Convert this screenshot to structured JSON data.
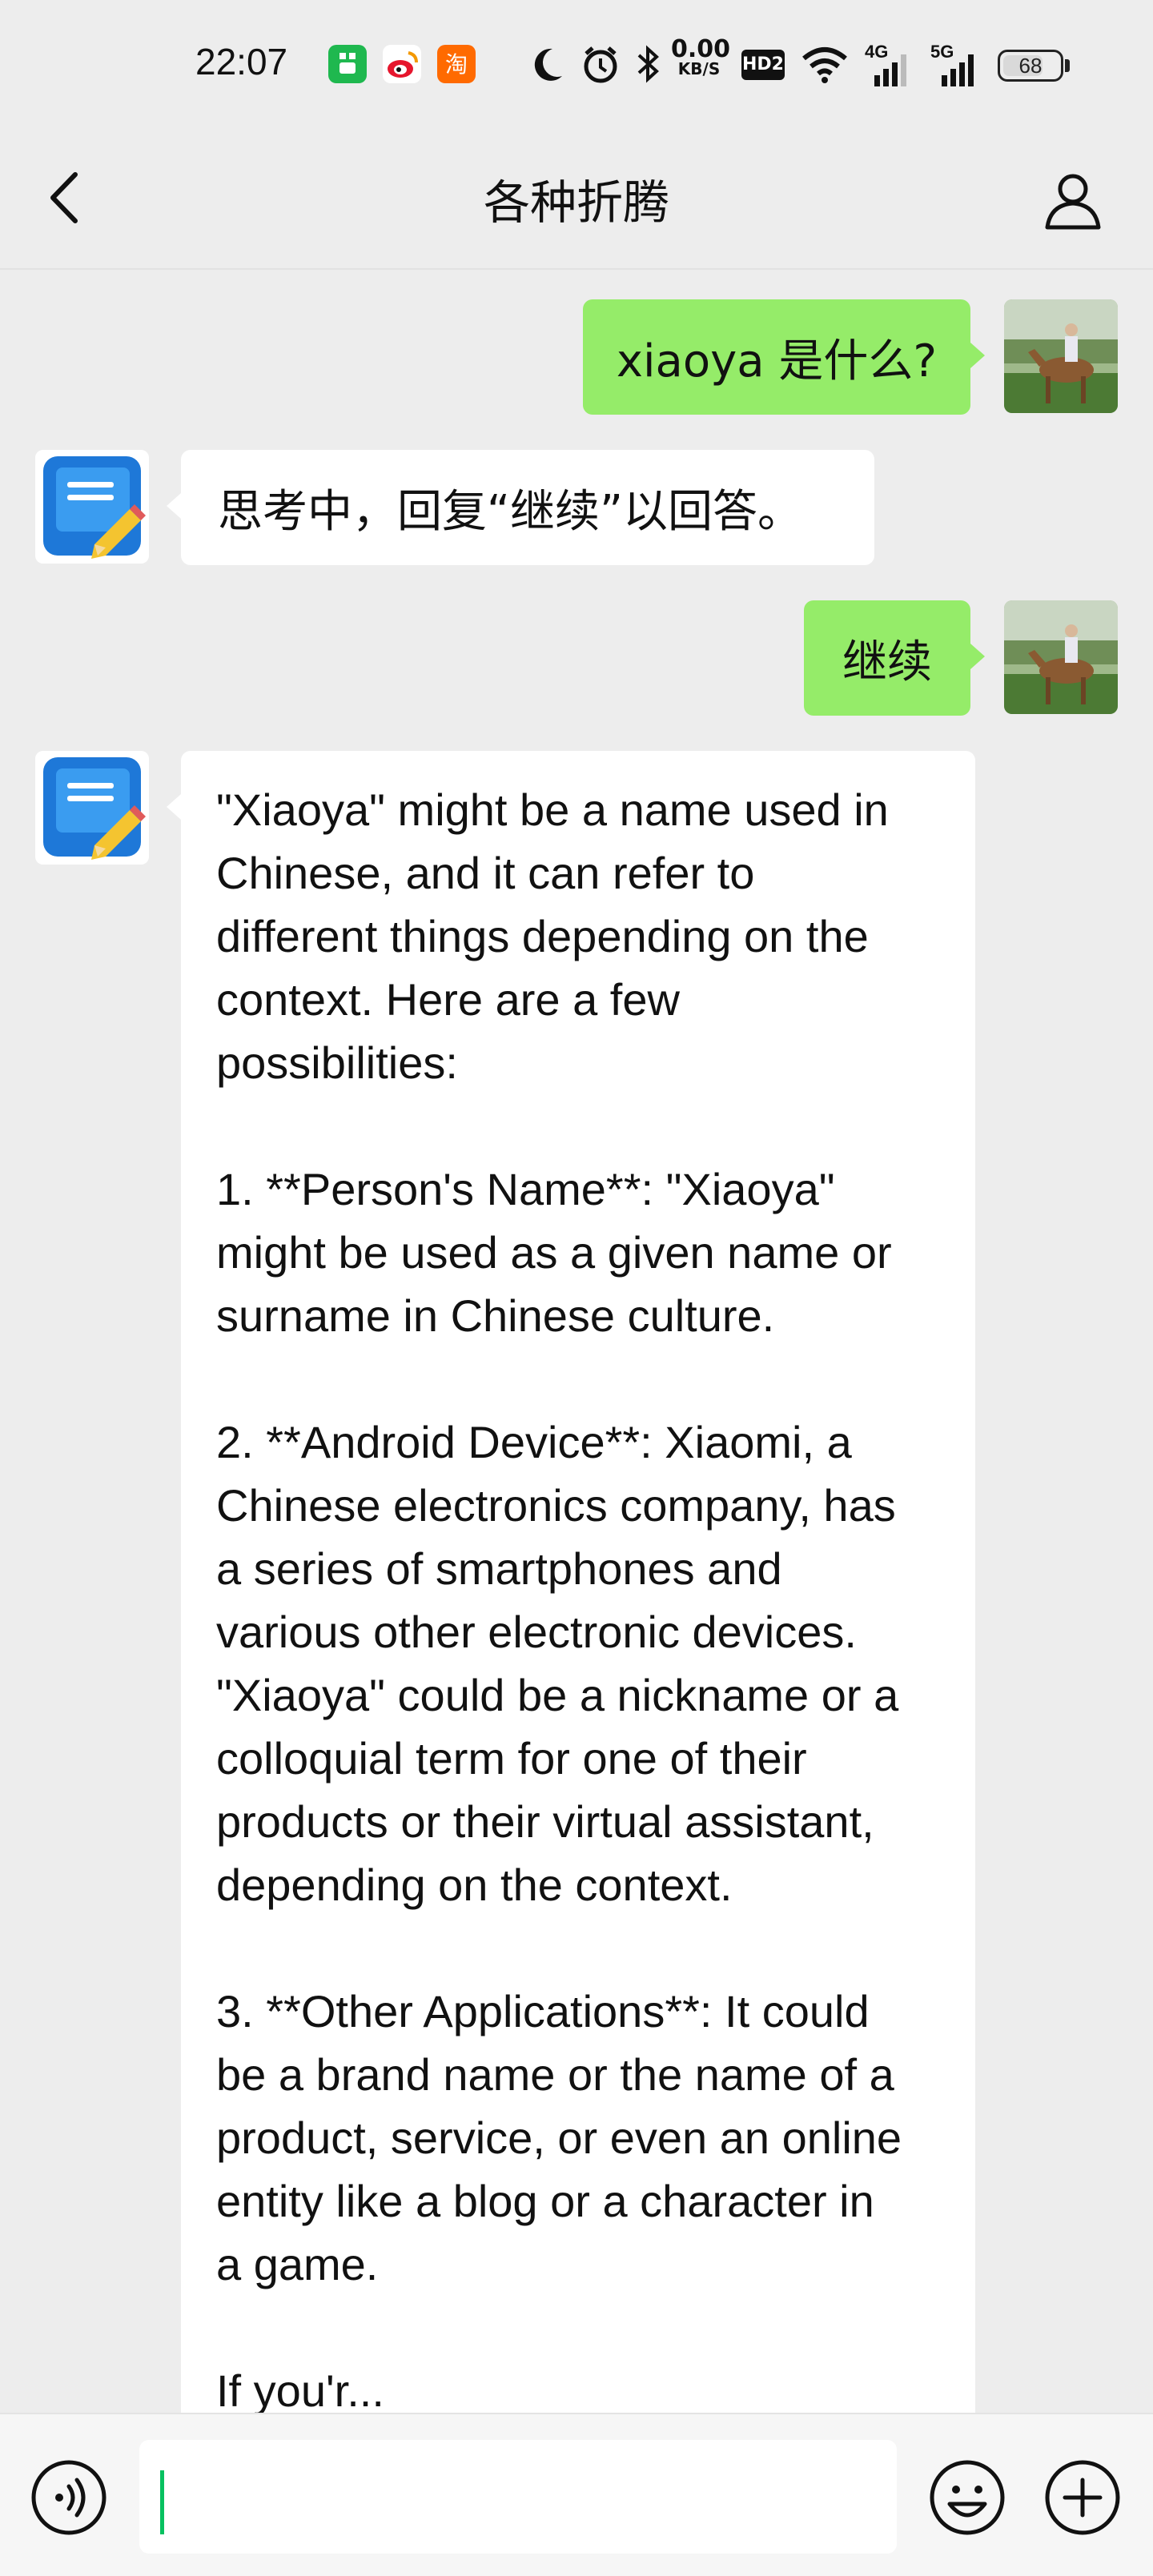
{
  "status_bar": {
    "time": "22:07",
    "net_speed_value": "0.00",
    "net_speed_unit": "KB/S",
    "hd_label": "HD2",
    "signal_4g_label": "4G",
    "signal_5g_label": "5G",
    "battery_level": "68",
    "icons": [
      "app-badge-green",
      "weibo-icon",
      "taobao-icon",
      "moon-icon",
      "alarm-icon",
      "bluetooth-icon",
      "wifi-icon"
    ]
  },
  "header": {
    "title": "各种折腾"
  },
  "messages": [
    {
      "sender": "me",
      "text": "xiaoya 是什么?"
    },
    {
      "sender": "bot",
      "text": "思考中，回复“继续”以回答。"
    },
    {
      "sender": "me",
      "text": "继续"
    },
    {
      "sender": "bot",
      "text": "\"Xiaoya\" might be a name used in\nChinese, and it can refer to\ndifferent things depending on the\ncontext. Here are a few\npossibilities:\n\n1. **Person's Name**: \"Xiaoya\"\nmight be used as a given name or\nsurname in Chinese culture.\n\n2. **Android Device**: Xiaomi, a\nChinese electronics company, has\na series of smartphones and\nvarious other electronic devices.\n\"Xiaoya\" could be a nickname or a\ncolloquial term for one of their\nproducts or their virtual assistant,\ndepending on the context.\n\n3. **Other Applications**: It could\nbe a brand name or the name of a\nproduct, service, or even an online\nentity like a blog or a character in\na game.\n\nIf you'r..."
    }
  ],
  "input_bar": {
    "value": ""
  },
  "colors": {
    "background": "#ededed",
    "outgoing_bubble": "#95ec69",
    "incoming_bubble": "#ffffff",
    "caret": "#07c160"
  }
}
